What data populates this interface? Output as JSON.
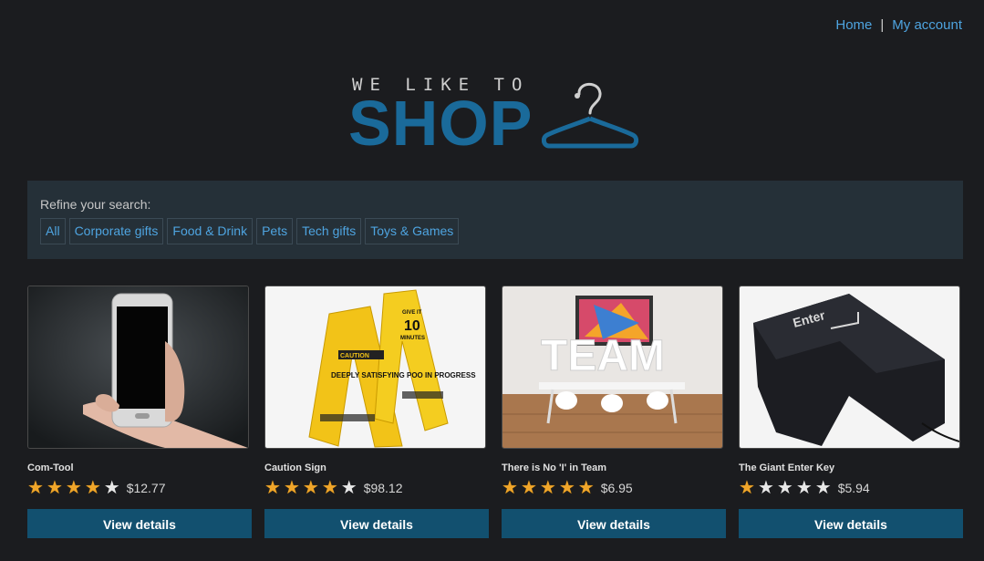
{
  "nav": {
    "home": "Home",
    "separator": "|",
    "account": "My account"
  },
  "logo": {
    "tagline": "WE LIKE TO",
    "word": "SHOP"
  },
  "refine": {
    "label": "Refine your search:",
    "filters": [
      "All",
      "Corporate gifts",
      "Food & Drink",
      "Pets",
      "Tech gifts",
      "Toys & Games"
    ]
  },
  "products": [
    {
      "name": "Com-Tool",
      "rating": 4,
      "price": "$12.77",
      "button": "View details",
      "image": "hand-holding-phone"
    },
    {
      "name": "Caution Sign",
      "rating": 4,
      "price": "$98.12",
      "button": "View details",
      "image": "yellow-caution-signs",
      "image_text": {
        "sign_header": "CAUTION",
        "sign_body": "DEEPLY SATISFYING POO IN PROGRESS",
        "sign2_top": "GIVE IT",
        "sign2_number": "10",
        "sign2_bottom": "MINUTES"
      }
    },
    {
      "name": "There is No 'I' in Team",
      "rating": 5,
      "price": "$6.95",
      "button": "View details",
      "image": "team-letters-office",
      "image_text": {
        "word": "TEAM"
      }
    },
    {
      "name": "The Giant Enter Key",
      "rating": 1,
      "price": "$5.94",
      "button": "View details",
      "image": "giant-enter-key-cushion",
      "image_text": {
        "key": "Enter"
      }
    }
  ],
  "colors": {
    "background": "#1b1c1f",
    "accent": "#12506f",
    "link": "#4ea4e0",
    "star": "#f0a62a"
  }
}
